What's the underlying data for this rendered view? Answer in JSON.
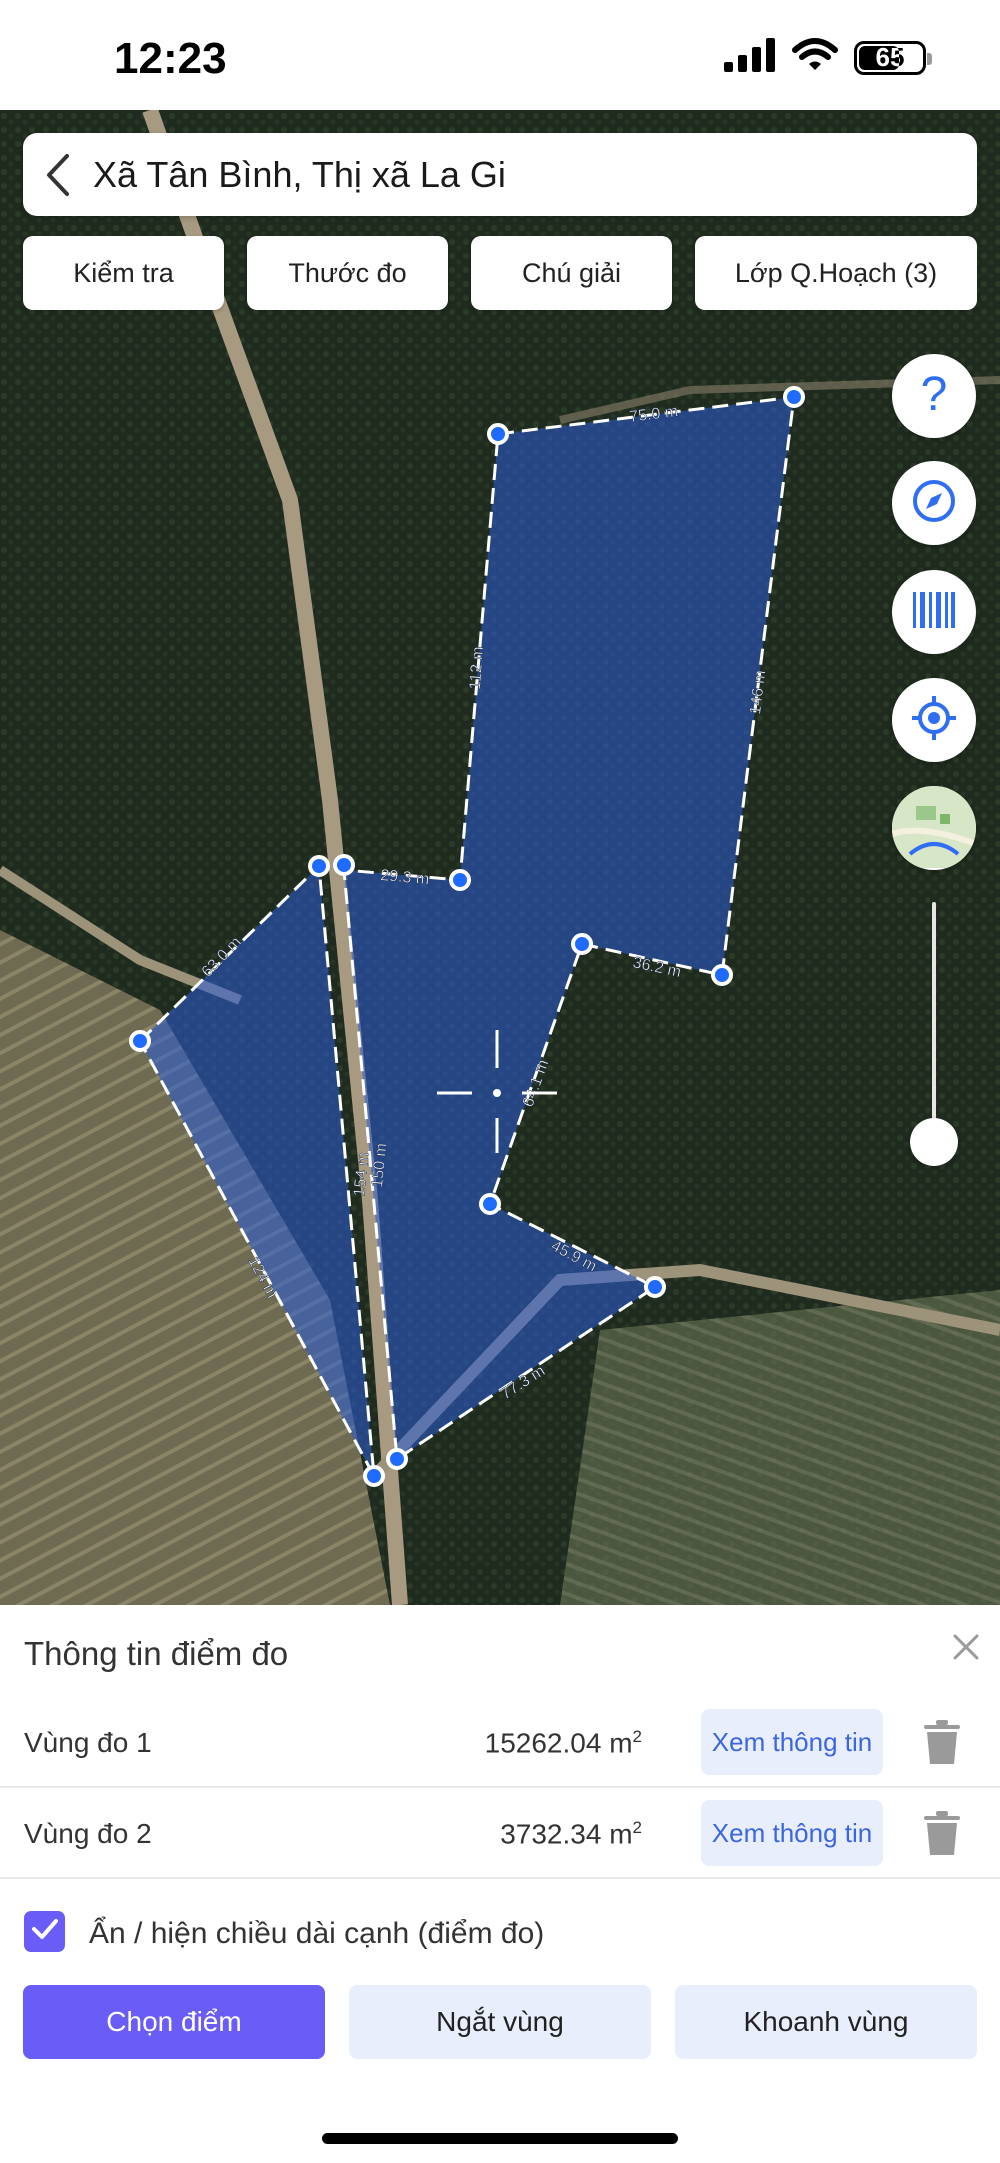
{
  "status_bar": {
    "time": "12:23",
    "battery": "65"
  },
  "search": {
    "location": "Xã Tân Bình, Thị xã La Gi"
  },
  "chips": [
    "Kiểm tra",
    "Thước đo",
    "Chú giải",
    "Lớp Q.Hoạch (3)"
  ],
  "map": {
    "fab_icons": [
      "help-icon",
      "compass-icon",
      "barcode-icon",
      "locate-icon",
      "map-layers-icon"
    ],
    "measurements": [
      "75.0 m",
      "112 m",
      "146 m",
      "29.3 m",
      "36.2 m",
      "63.0 m",
      "154 m",
      "150 m",
      "64.1 m",
      "124 m",
      "45.9 m",
      "77.3 m"
    ]
  },
  "panel": {
    "title": "Thông tin điểm đo",
    "areas": [
      {
        "label": "Vùng đo 1",
        "value": "15262.04 m",
        "unit_sup": "2",
        "button": "Xem thông tin"
      },
      {
        "label": "Vùng đo 2",
        "value": "3732.34 m",
        "unit_sup": "2",
        "button": "Xem thông tin"
      }
    ],
    "toggle_label": "Ẩn / hiện chiều dài cạnh (điểm đo)",
    "toggle_checked": true,
    "actions": {
      "select_point": "Chọn điểm",
      "split_region": "Ngắt vùng",
      "enclose_region": "Khoanh vùng"
    }
  },
  "colors": {
    "accent": "#6a5cf6",
    "button_tint": "#e9eefc",
    "link_blue": "#3b66e0",
    "polygon_fill": "#2a5bd7",
    "vertex": "#1f6bff"
  }
}
